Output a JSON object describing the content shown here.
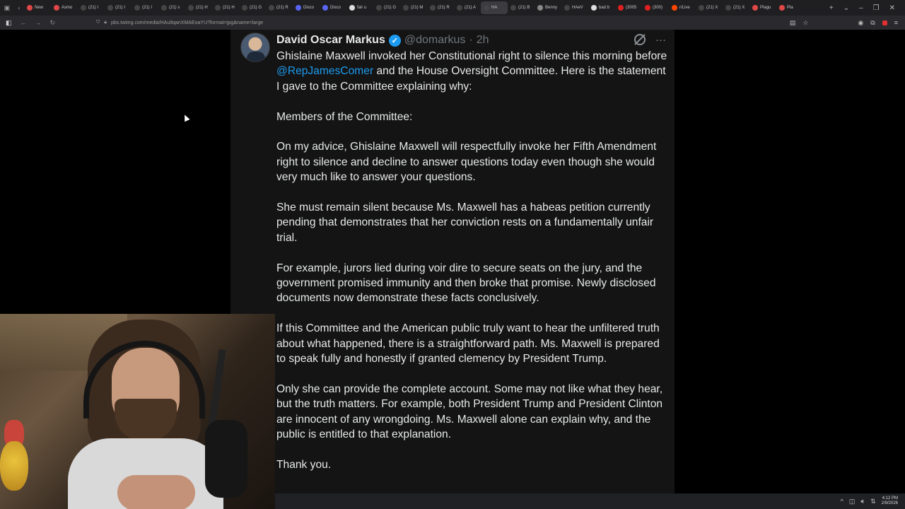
{
  "browser": {
    "tabs": [
      {
        "label": "New",
        "icon": "app-icon",
        "color": "#e04848"
      },
      {
        "label": "Asmo",
        "icon": "app-icon",
        "color": "#e04848"
      },
      {
        "label": "(21) I",
        "icon": "x-icon",
        "color": "#444444"
      },
      {
        "label": "(21) I",
        "icon": "x-icon",
        "color": "#444444"
      },
      {
        "label": "(21) I",
        "icon": "x-icon",
        "color": "#444444"
      },
      {
        "label": "(21) s",
        "icon": "x-icon",
        "color": "#444444"
      },
      {
        "label": "(21) H",
        "icon": "x-icon",
        "color": "#444444"
      },
      {
        "label": "(21) H",
        "icon": "x-icon",
        "color": "#444444"
      },
      {
        "label": "(21) G",
        "icon": "x-icon",
        "color": "#444444"
      },
      {
        "label": "(21) R",
        "icon": "x-icon",
        "color": "#444444"
      },
      {
        "label": "Disco",
        "icon": "discord-icon",
        "color": "#5865f2"
      },
      {
        "label": "Disco",
        "icon": "discord-icon",
        "color": "#5865f2"
      },
      {
        "label": "fair u",
        "icon": "google-icon",
        "color": "#dddddd"
      },
      {
        "label": "(21) G",
        "icon": "x-icon",
        "color": "#444444"
      },
      {
        "label": "(21) M",
        "icon": "x-icon",
        "color": "#444444"
      },
      {
        "label": "(21) R",
        "icon": "x-icon",
        "color": "#444444"
      },
      {
        "label": "(21) A",
        "icon": "x-icon",
        "color": "#444444"
      },
      {
        "label": "HA",
        "icon": "x-icon",
        "color": "#444444",
        "active": true
      },
      {
        "label": "(21) B",
        "icon": "x-icon",
        "color": "#444444"
      },
      {
        "label": "Benny",
        "icon": "generic-icon",
        "color": "#888888"
      },
      {
        "label": "HAeV",
        "icon": "x-icon",
        "color": "#444444"
      },
      {
        "label": "bad b",
        "icon": "google-icon",
        "color": "#dddddd"
      },
      {
        "label": "(3005",
        "icon": "youtube-icon",
        "color": "#e02020"
      },
      {
        "label": "(300)",
        "icon": "youtube-icon",
        "color": "#e02020"
      },
      {
        "label": "r/Live",
        "icon": "reddit-icon",
        "color": "#ff4500"
      },
      {
        "label": "(21) X",
        "icon": "x-icon",
        "color": "#444444"
      },
      {
        "label": "(21) X",
        "icon": "x-icon",
        "color": "#444444"
      },
      {
        "label": "Plagu",
        "icon": "app-icon",
        "color": "#e04848"
      },
      {
        "label": "Pla",
        "icon": "app-icon",
        "color": "#e04848"
      }
    ],
    "url": "pbs.twimg.com/media/HAu9qanXMAEoaYU?format=jpg&name=large"
  },
  "tweet": {
    "name": "David Oscar Markus",
    "handle": "@domarkus",
    "time": "2h",
    "line1_pre": "Ghislaine Maxwell invoked her Constitutional right to silence this morning before ",
    "mention": "@RepJamesComer",
    "line1_post": " and the House Oversight Committee. Here is the statement I gave to the Committee explaining why:",
    "paragraphs": [
      "Members of the Committee:",
      "On my advice, Ghislaine Maxwell will respectfully invoke her Fifth Amendment right to silence and decline to answer questions today even though she would very much like to answer your questions.",
      "She must remain silent because Ms. Maxwell has a habeas petition currently pending that demonstrates that her conviction rests on a fundamentally unfair trial.",
      "For example, jurors lied during voir dire to secure seats on the jury, and the government promised immunity and then broke that promise. Newly disclosed documents now demonstrate these facts conclusively.",
      "If this Committee and the American public truly want to hear the unfiltered truth about what happened, there is a straightforward path. Ms. Maxwell is prepared to speak fully and honestly if granted clemency by President Trump.",
      "Only she can provide the complete account. Some may not like what they hear, but the truth matters. For example, both President Trump and President Clinton are innocent of any wrongdoing. Ms. Maxwell alone can explain why, and the public is entitled to that explanation.",
      "Thank you."
    ]
  },
  "taskbar": {
    "time": "4:12 PM",
    "date": "2/9/2026"
  },
  "colors": {
    "link": "#1d9bf0",
    "card_bg": "#141414",
    "text": "#e7e9ea",
    "muted": "#71767b"
  }
}
